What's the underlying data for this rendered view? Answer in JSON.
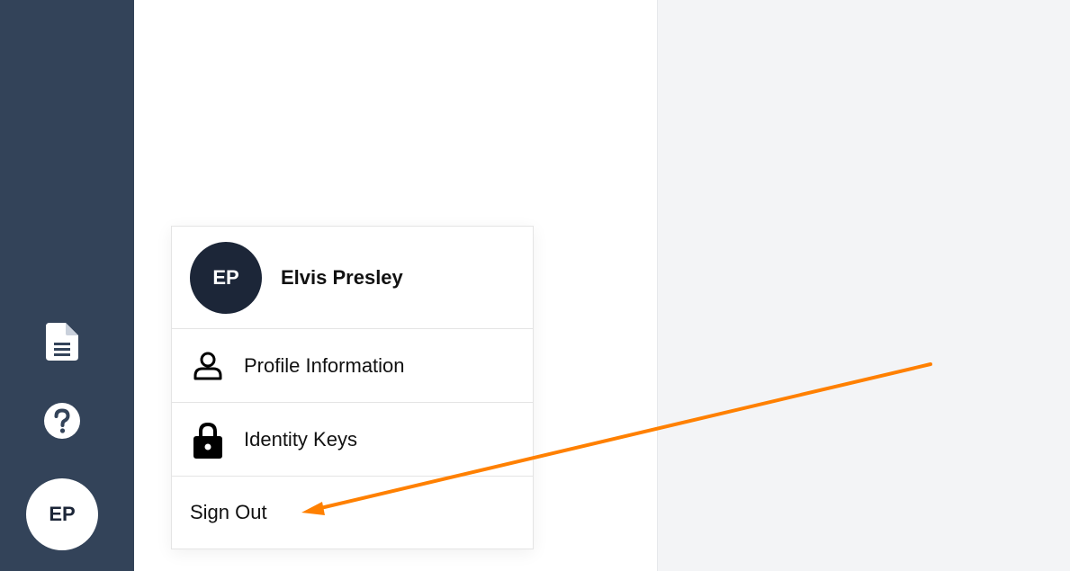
{
  "sidebar": {
    "icons": [
      "document-icon",
      "help-icon"
    ],
    "avatar_initials": "EP"
  },
  "user_menu": {
    "avatar_initials": "EP",
    "user_name": "Elvis Presley",
    "items": [
      {
        "label": "Profile Information",
        "icon": "person-icon"
      },
      {
        "label": "Identity Keys",
        "icon": "lock-icon"
      }
    ],
    "sign_out_label": "Sign Out"
  },
  "annotation": {
    "arrow_color": "#ff8000"
  },
  "colors": {
    "sidebar_bg": "#334359",
    "avatar_dark": "#1c2638",
    "right_panel_bg": "#f3f4f6"
  }
}
